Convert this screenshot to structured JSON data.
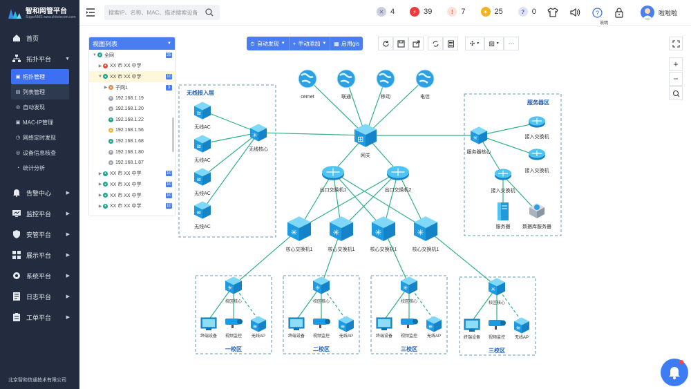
{
  "brand": {
    "title": "智和网管平台",
    "sub": "SugarNMS www.zhitelecom.com"
  },
  "sidebar": {
    "items": [
      {
        "label": "首页",
        "icon": "home-icon"
      },
      {
        "label": "拓扑平台",
        "icon": "topology-icon",
        "arrow": "▼"
      },
      {
        "label": "告警中心",
        "icon": "bell-icon",
        "arrow": "▶"
      },
      {
        "label": "监控平台",
        "icon": "monitor-icon",
        "arrow": "▶"
      },
      {
        "label": "安管平台",
        "icon": "shield-icon",
        "arrow": "▶"
      },
      {
        "label": "展示平台",
        "icon": "grid-icon",
        "arrow": "▶"
      },
      {
        "label": "系统平台",
        "icon": "gear-icon",
        "arrow": "▶"
      },
      {
        "label": "日志平台",
        "icon": "log-icon",
        "arrow": "▶"
      },
      {
        "label": "工单平台",
        "icon": "ticket-icon",
        "arrow": "▶"
      }
    ],
    "sub": [
      {
        "label": "拓扑管理"
      },
      {
        "label": "列表管理"
      },
      {
        "label": "自动发现"
      },
      {
        "label": "MAC-IP管理"
      },
      {
        "label": "网络定时发现"
      },
      {
        "label": "设备信息核查"
      },
      {
        "label": "统计分析"
      }
    ],
    "footer": "北京智和信通技术有限公司"
  },
  "search": {
    "placeholder": "搜索IP、名称、MAC、描述搜索设备"
  },
  "badges": [
    {
      "value": "4",
      "color": "#c9cfe0",
      "glyph": "✕",
      "fg": "#5a6478"
    },
    {
      "value": "39",
      "color": "#f03b3b",
      "glyph": "⚡",
      "fg": "#fff"
    },
    {
      "value": "7",
      "color": "#fbe1dc",
      "glyph": "!",
      "fg": "#f05a3b"
    },
    {
      "value": "25",
      "color": "#f6b21b",
      "glyph": "☀",
      "fg": "#fff"
    },
    {
      "value": "0",
      "color": "#dfe3f5",
      "glyph": "?",
      "fg": "#4a5fd0"
    }
  ],
  "user": {
    "name": "啦啦啦"
  },
  "tooltip": "说明",
  "tree": {
    "title": "视图列表",
    "rows": [
      {
        "label": "全网",
        "indent": 0,
        "tw": "▼",
        "dot": "#1aa48a",
        "count": "25",
        "sel": false
      },
      {
        "label": "XX 市 XX 中学",
        "indent": 1,
        "tw": "▶",
        "dot": "#e0463a",
        "count": "",
        "sel": false
      },
      {
        "label": "XX 市 XX 中学",
        "indent": 1,
        "tw": "▼",
        "dot": "#1aa48a",
        "count": "10",
        "sel": true
      },
      {
        "label": "子网1",
        "indent": 2,
        "tw": "▶",
        "dot": "#e8864a",
        "count": "3",
        "sel": false
      },
      {
        "label": "192.168.1.19",
        "indent": 2,
        "tw": "",
        "dot": "#9aa3ad",
        "count": "",
        "sel": false
      },
      {
        "label": "192.168.1.20",
        "indent": 2,
        "tw": "",
        "dot": "#9aa3ad",
        "count": "",
        "sel": false
      },
      {
        "label": "192.168.1.22",
        "indent": 2,
        "tw": "",
        "dot": "#1aa48a",
        "count": "",
        "sel": false
      },
      {
        "label": "192.168.1.56",
        "indent": 2,
        "tw": "",
        "dot": "#f0b92a",
        "count": "",
        "sel": false
      },
      {
        "label": "192.168.1.68",
        "indent": 2,
        "tw": "",
        "dot": "#1aa48a",
        "count": "",
        "sel": false
      },
      {
        "label": "192.168.1.80",
        "indent": 2,
        "tw": "",
        "dot": "#9aa3ad",
        "count": "",
        "sel": false
      },
      {
        "label": "192.168.1.87",
        "indent": 2,
        "tw": "",
        "dot": "#9aa3ad",
        "count": "",
        "sel": false
      },
      {
        "label": "XX 市 XX 中学",
        "indent": 1,
        "tw": "▶",
        "dot": "#1aa48a",
        "count": "10",
        "sel": false
      },
      {
        "label": "XX 市 XX 中学",
        "indent": 1,
        "tw": "▶",
        "dot": "#1aa48a",
        "count": "10",
        "sel": false
      },
      {
        "label": "XX 市 XX 中学",
        "indent": 1,
        "tw": "▶",
        "dot": "#1aa48a",
        "count": "10",
        "sel": false
      },
      {
        "label": "XX 市 XX 中学",
        "indent": 1,
        "tw": "▶",
        "dot": "#1aa48a",
        "count": "10",
        "sel": false
      }
    ]
  },
  "toolbar": {
    "auto": "自动发现",
    "manual": "手动添加",
    "gis": "启用gis"
  },
  "topo": {
    "regions": {
      "wireless": "无线接入层",
      "server": "服务器区",
      "z1": "一校区",
      "z2": "二校区",
      "z3": "三校区",
      "z4": "三校区"
    },
    "clouds": [
      "cernet",
      "联通",
      "移动",
      "电信"
    ],
    "gateway": "网关",
    "wifiCore": "无线核心",
    "ac": "无线AC",
    "exits": [
      "出口交换机1",
      "出口交换机2"
    ],
    "cores": [
      "核心交换机1",
      "核心交换机1",
      "核心交换机1",
      "核心交换机1"
    ],
    "srvCore": "服务器核心",
    "access": "接入交换机",
    "server": "服务器",
    "db": "数据库服务器",
    "campusCore": "校区核心",
    "terminal": "终端设备",
    "camera": "视频监控",
    "ap": "无线AP"
  }
}
